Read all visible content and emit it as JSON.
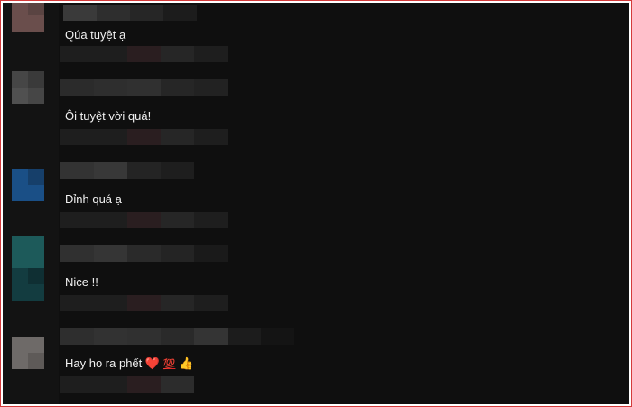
{
  "comments": [
    {
      "text": "Qúa tuyệt ạ"
    },
    {
      "text": "Ôi tuyệt vời quá!"
    },
    {
      "text": "Đỉnh quá ạ"
    },
    {
      "text": "Nice !!"
    },
    {
      "text": "Hay ho ra phết",
      "emojis": [
        "❤️",
        "💯",
        "👍"
      ]
    }
  ],
  "colors": {
    "background": "#0f0f0f",
    "text": "#f1f1f1",
    "frame_border": "#d43a3a",
    "avatar_1": "#6a4e4c",
    "avatar_2": "#464646",
    "avatar_3": "#1a4f86",
    "avatar_4": "#1d5a5a",
    "avatar_5": "#6e6a68"
  },
  "icons": [
    "heart-emoji",
    "hundred-points-emoji",
    "thumbs-up-emoji"
  ]
}
